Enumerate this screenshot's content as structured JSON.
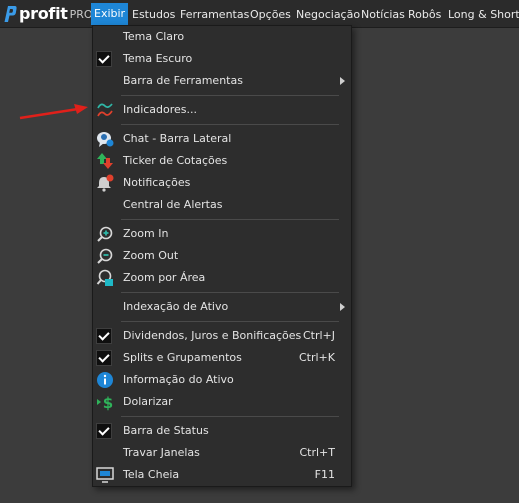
{
  "logo": {
    "brand": "profit",
    "suffix": "PRO"
  },
  "menubar": {
    "items": [
      "Exibir",
      "Estudos",
      "Ferramentas",
      "Opções",
      "Negociação",
      "Notícias",
      "Robôs",
      "Long & Short"
    ],
    "active": "Exibir"
  },
  "dropdown": {
    "items": [
      {
        "label": "Tema Claro",
        "checked": false
      },
      {
        "label": "Tema Escuro",
        "checked": true
      },
      {
        "label": "Barra de Ferramentas",
        "submenu": true
      },
      {
        "label": "Indicadores...",
        "icon": "indicators-icon"
      },
      {
        "label": "Chat - Barra Lateral",
        "icon": "chat-icon"
      },
      {
        "label": "Ticker de Cotações",
        "icon": "ticker-arrows-icon"
      },
      {
        "label": "Notificações",
        "icon": "bell-icon"
      },
      {
        "label": "Central de Alertas"
      },
      {
        "label": "Zoom In",
        "icon": "zoom-in-icon"
      },
      {
        "label": "Zoom Out",
        "icon": "zoom-out-icon"
      },
      {
        "label": "Zoom por Área",
        "icon": "zoom-area-icon"
      },
      {
        "label": "Indexação de Ativo",
        "submenu": true
      },
      {
        "label": "Dividendos, Juros e Bonificações",
        "checked": true,
        "shortcut": "Ctrl+J"
      },
      {
        "label": "Splits e Grupamentos",
        "checked": true,
        "shortcut": "Ctrl+K"
      },
      {
        "label": "Informação do Ativo",
        "icon": "info-icon"
      },
      {
        "label": "Dolarizar",
        "icon": "dollar-icon"
      },
      {
        "label": "Barra de Status",
        "checked": true
      },
      {
        "label": "Travar Janelas",
        "shortcut": "Ctrl+T"
      },
      {
        "label": "Tela Cheia",
        "icon": "fullscreen-icon",
        "shortcut": "F11"
      }
    ]
  },
  "colors": {
    "accent": "#1e86d6",
    "menu_bg": "#2d2d2d",
    "annotation_arrow": "#e0201a"
  }
}
